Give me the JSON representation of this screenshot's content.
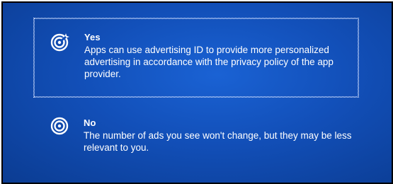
{
  "options": [
    {
      "title": "Yes",
      "description": "Apps can use advertising ID to provide more personalized advertising in accordance with the privacy policy of the app provider.",
      "icon": "target-sparkle-icon",
      "selected": true
    },
    {
      "title": "No",
      "description": "The number of ads you see won't change, but they may be less relevant to you.",
      "icon": "target-icon",
      "selected": false
    }
  ],
  "colors": {
    "background": "#124fb8",
    "text": "#ffffff",
    "focus_border": "#c8d8ff"
  }
}
